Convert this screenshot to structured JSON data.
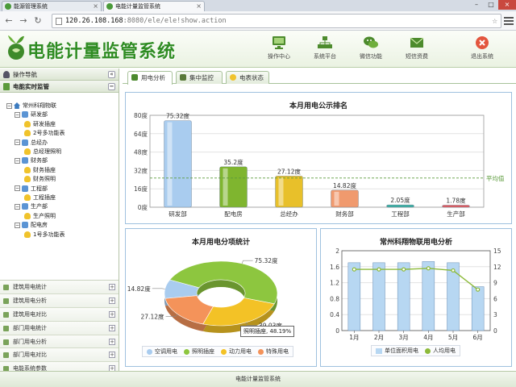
{
  "browser": {
    "tabs": [
      {
        "label": "能源管理系统"
      },
      {
        "label": "电能计量监管系统"
      }
    ],
    "url_host": "120.26.108.168",
    "url_rest": ":8080/ele/ele!show.action"
  },
  "header": {
    "title": "电能计量监管系统",
    "nav": [
      {
        "label": "操作中心",
        "icon": "monitor-icon"
      },
      {
        "label": "系统平台",
        "icon": "network-icon"
      },
      {
        "label": "微信功能",
        "icon": "wechat-icon"
      },
      {
        "label": "短信资费",
        "icon": "envelope-icon"
      },
      {
        "label": "退出系统",
        "icon": "exit-icon"
      }
    ]
  },
  "sidebar": {
    "header": "操作导航",
    "section": "电能实时监管",
    "tree": [
      {
        "label": "常州科翔物联",
        "level": 0,
        "type": "home"
      },
      {
        "label": "研发部",
        "level": 1,
        "type": "org"
      },
      {
        "label": "研发插座",
        "level": 2,
        "type": "bulb"
      },
      {
        "label": "2号多功能表",
        "level": 2,
        "type": "bulb"
      },
      {
        "label": "总经办",
        "level": 1,
        "type": "org"
      },
      {
        "label": "总经理照明",
        "level": 2,
        "type": "bulb"
      },
      {
        "label": "财务部",
        "level": 1,
        "type": "org"
      },
      {
        "label": "财务插座",
        "level": 2,
        "type": "bulb"
      },
      {
        "label": "财务照明",
        "level": 2,
        "type": "bulb"
      },
      {
        "label": "工程部",
        "level": 1,
        "type": "org"
      },
      {
        "label": "工程插座",
        "level": 2,
        "type": "bulb"
      },
      {
        "label": "生产部",
        "level": 1,
        "type": "org"
      },
      {
        "label": "生产照明",
        "level": 2,
        "type": "bulb"
      },
      {
        "label": "配电房",
        "level": 1,
        "type": "org"
      },
      {
        "label": "1号多功能表",
        "level": 2,
        "type": "bulb"
      }
    ],
    "accordion": [
      "建筑用电统计",
      "建筑用电分析",
      "建筑用电对比",
      "部门用电统计",
      "部门用电分析",
      "部门用电对比",
      "电能系统参数"
    ]
  },
  "tabs": [
    {
      "label": "用电分析",
      "active": true
    },
    {
      "label": "集中监控",
      "active": false
    },
    {
      "label": "电表状态",
      "active": false
    }
  ],
  "footer": "电能计量监管系统",
  "chart_data": [
    {
      "type": "bar",
      "title": "本月用电公示排名",
      "categories": [
        "研发部",
        "配电房",
        "总经办",
        "财务部",
        "工程部",
        "生产部"
      ],
      "values": [
        75.32,
        35.2,
        27.12,
        14.82,
        2.05,
        1.78
      ],
      "value_labels": [
        "75.32度",
        "35.2度",
        "27.12度",
        "14.82度",
        "2.05度",
        "1.78度"
      ],
      "colors": [
        "#a9ccef",
        "#7fb52f",
        "#e8c02a",
        "#f09a6e",
        "#3aaea3",
        "#e05a60"
      ],
      "yticks": [
        "0度",
        "16度",
        "32度",
        "48度",
        "64度",
        "80度"
      ],
      "ylim": [
        0,
        80
      ],
      "average": 25.38,
      "average_label": "平均值",
      "grid": true
    },
    {
      "type": "pie",
      "title": "本月用电分项统计",
      "slices": [
        {
          "name": "空调用电",
          "value": 14.82,
          "label": "14.82度",
          "color": "#a9ccef"
        },
        {
          "name": "照明插座",
          "value": 75.32,
          "label": "75.32度",
          "color": "#8dc63f"
        },
        {
          "name": "动力用电",
          "value": 39.03,
          "label": "39.03度",
          "color": "#f3c226"
        },
        {
          "name": "特殊用电",
          "value": 27.12,
          "label": "27.12度",
          "color": "#f4935a"
        }
      ],
      "tooltip": "照明插座, 48.19%",
      "legend": "bottom"
    },
    {
      "type": "bar+line",
      "title": "常州科翔物联用电分析",
      "categories": [
        "1月",
        "2月",
        "3月",
        "4月",
        "5月",
        "6月"
      ],
      "series": [
        {
          "name": "单位面积用电",
          "type": "bar",
          "axis": "left",
          "values": [
            1.7,
            1.7,
            1.7,
            1.73,
            1.7,
            1.1
          ],
          "color": "#b7d7f2"
        },
        {
          "name": "人均用电",
          "type": "line",
          "axis": "right",
          "values": [
            11.5,
            11.5,
            11.5,
            11.7,
            11.3,
            7.7
          ],
          "color": "#8dba3a"
        }
      ],
      "yleft_ticks": [
        "0",
        "0.4",
        "0.8",
        "1.2",
        "1.6",
        "2"
      ],
      "yright_ticks": [
        "0",
        "3",
        "6",
        "9",
        "12",
        "15"
      ],
      "yleft_lim": [
        0,
        2
      ],
      "yright_lim": [
        0,
        15
      ],
      "legend": "bottom"
    }
  ]
}
